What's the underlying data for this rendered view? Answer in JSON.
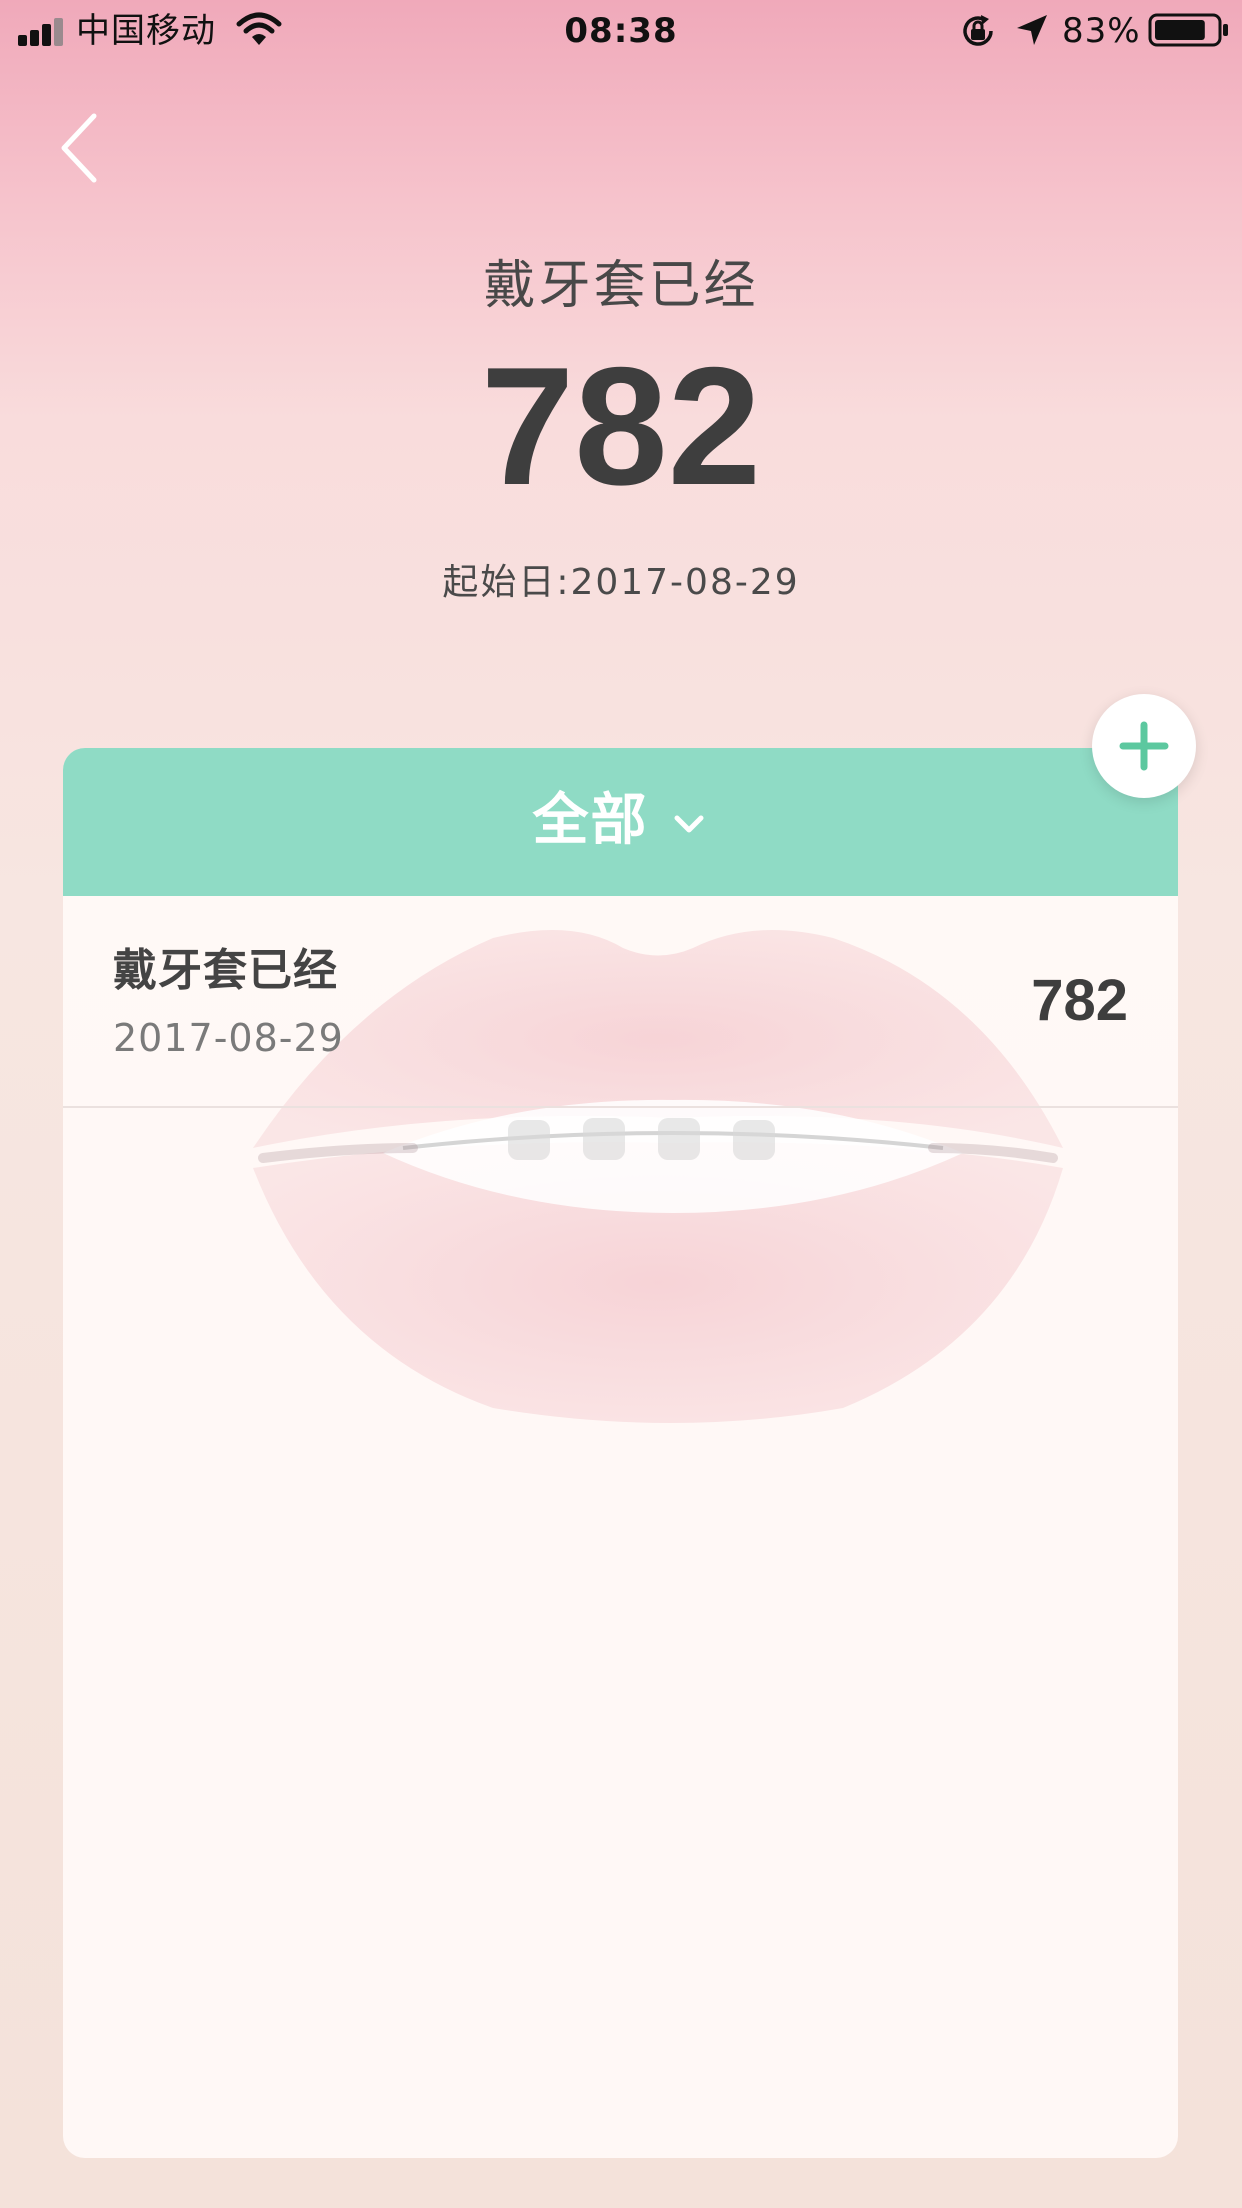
{
  "status_bar": {
    "carrier": "中国移动",
    "time": "08:38",
    "battery_percent": "83%",
    "battery_level": 0.83
  },
  "header": {
    "title": "戴牙套已经",
    "count": "782",
    "start_date": "起始日:2017-08-29"
  },
  "filter": {
    "label": "全部"
  },
  "list": {
    "items": [
      {
        "title": "戴牙套已经",
        "date": "2017-08-29",
        "count": "782"
      }
    ]
  },
  "colors": {
    "accent": "#8fdbc5",
    "add_icon": "#5cc89f",
    "text_dark": "#3e3e3e"
  },
  "icons": {
    "back": "back-chevron-icon",
    "add": "plus-icon",
    "dropdown": "chevron-down-icon",
    "signal": "signal-bars-icon",
    "wifi": "wifi-icon",
    "lock": "orientation-lock-icon",
    "location": "location-arrow-icon",
    "battery": "battery-icon"
  }
}
